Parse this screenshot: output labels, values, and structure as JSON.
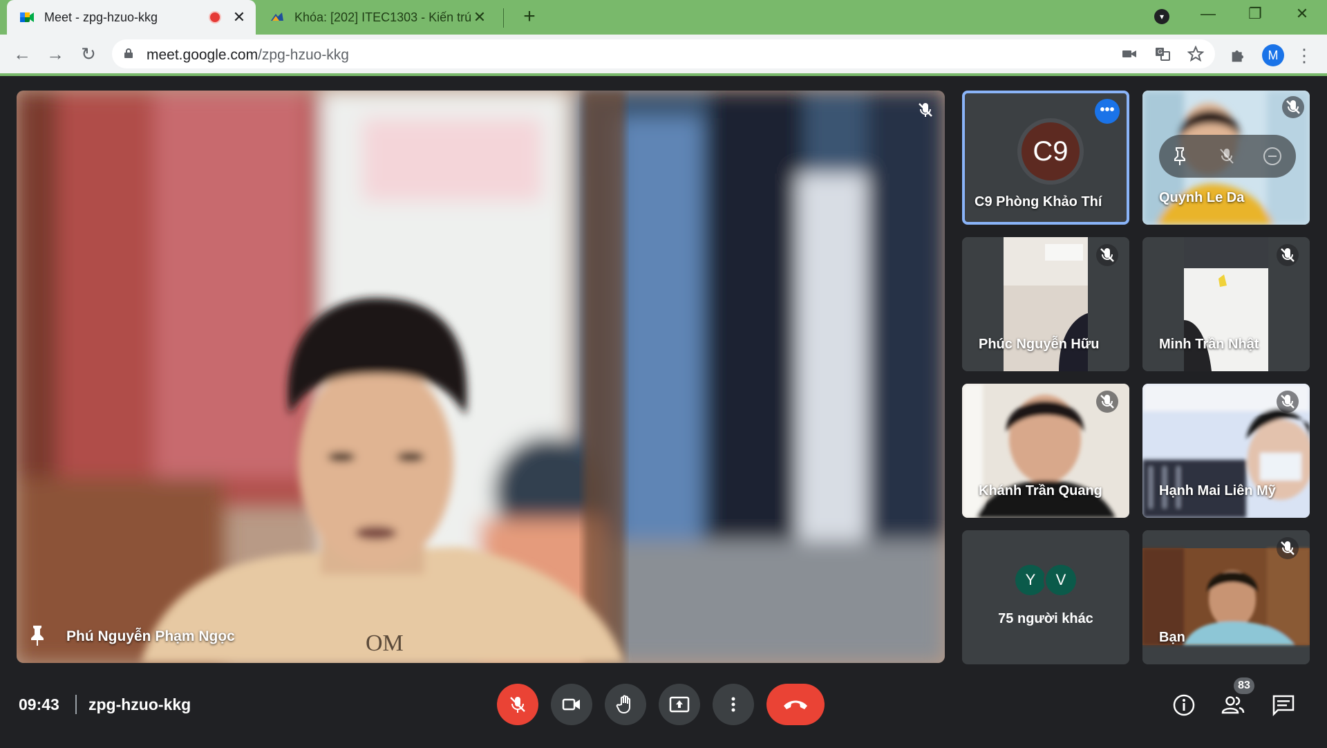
{
  "browser": {
    "tabs": [
      {
        "title": "Meet - zpg-hzuo-kkg",
        "active": true,
        "recording": true
      },
      {
        "title": "Khóa: [202] ITEC1303 - Kiến trúc",
        "active": false
      }
    ],
    "new_tab_symbol": "+",
    "url_host": "meet.google.com",
    "url_path": "/zpg-hzuo-kkg",
    "profile_initial": "M",
    "icons": [
      "back-icon",
      "forward-icon",
      "reload-icon",
      "lock-icon",
      "camera-icon",
      "translate-icon",
      "star-icon",
      "extensions-icon",
      "more-icon"
    ]
  },
  "meet": {
    "main_speaker": {
      "name": "Phú Nguyễn Phạm Ngọc",
      "pinned": true,
      "muted": true
    },
    "tiles": [
      {
        "name": "C9 Phòng Khảo Thí",
        "initials": "C9",
        "selected": true,
        "avatar_color": "#5d2a21"
      },
      {
        "name": "Quynh Le Da",
        "muted": true,
        "hover_controls": [
          "pin-icon",
          "mute-icon",
          "remove-icon"
        ]
      },
      {
        "name": "Phúc Nguyễn Hữu",
        "muted": true
      },
      {
        "name": "Minh Trần Nhật",
        "muted": true
      },
      {
        "name": "Khánh Trần Quang",
        "muted": true
      },
      {
        "name": "Hạnh Mai Liên Mỹ",
        "muted": true
      },
      {
        "name": "75 người khác",
        "initials": [
          "Y",
          "V"
        ]
      },
      {
        "name": "Bạn",
        "muted": true
      }
    ],
    "bottom_bar": {
      "time": "09:43",
      "meeting_code": "zpg-hzuo-kkg",
      "controls": [
        "mic-off-button",
        "camera-button",
        "raise-hand-button",
        "present-button",
        "more-options-button",
        "leave-call-button"
      ],
      "participant_count": "83",
      "right_icons": [
        "info-icon",
        "people-icon",
        "chat-icon"
      ]
    },
    "colors": {
      "background": "#202124",
      "tile": "#3c4043",
      "accent": "#1a73e8",
      "danger": "#ea4335",
      "selection": "#8ab4f8"
    }
  }
}
